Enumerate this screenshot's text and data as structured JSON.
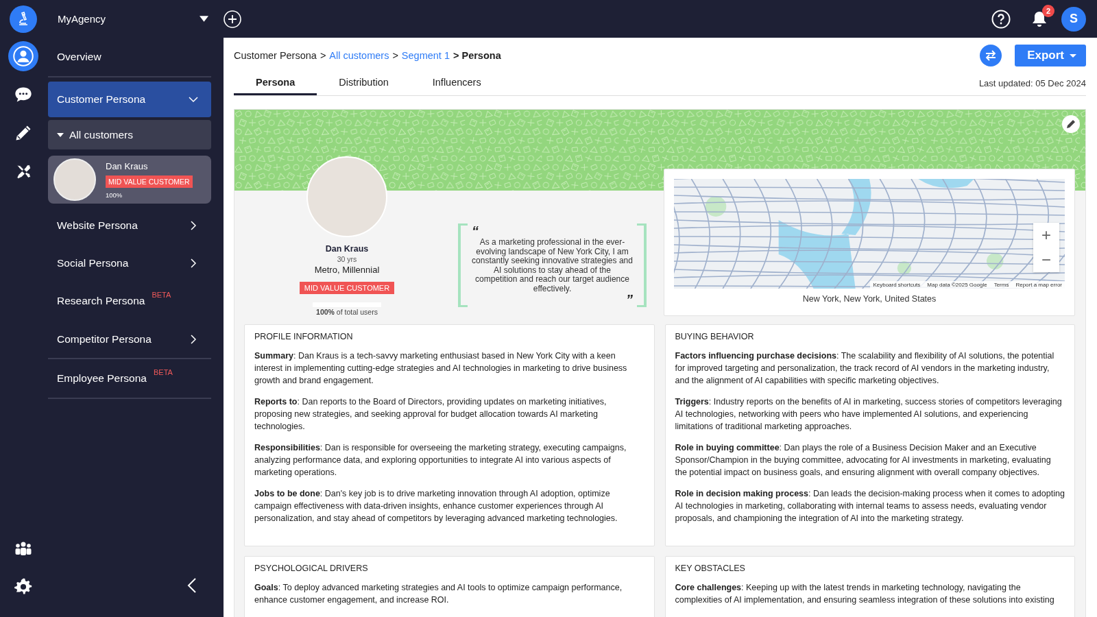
{
  "topbar": {
    "workspace": "MyAgency",
    "notifications": "2",
    "avatar": "S"
  },
  "rail": [
    {
      "selected": true
    },
    {
      "selected": false
    },
    {
      "selected": false
    },
    {
      "selected": false
    }
  ],
  "sidebar": {
    "items": [
      {
        "kind": "link",
        "label": "Overview",
        "selected": false
      },
      {
        "kind": "group",
        "label": "Customer Persona",
        "selected": true,
        "expanded": true,
        "children": [
          {
            "label": "All customers",
            "expanded": true,
            "children": [
              {
                "name": "Dan Kraus",
                "tag": "MID VALUE CUSTOMER",
                "share": "100%",
                "selected": true
              }
            ]
          }
        ]
      },
      {
        "kind": "group",
        "label": "Website Persona",
        "selected": false,
        "expanded": false
      },
      {
        "kind": "group",
        "label": "Social Persona",
        "selected": false,
        "expanded": false
      },
      {
        "kind": "link",
        "label": "Research Persona",
        "badge": "BETA",
        "selected": false
      },
      {
        "kind": "group",
        "label": "Competitor Persona",
        "selected": false,
        "expanded": false
      },
      {
        "kind": "link",
        "label": "Employee Persona",
        "badge": "BETA",
        "selected": false
      }
    ]
  },
  "breadcrumb": [
    {
      "kind": "text",
      "label": "Customer Persona"
    },
    {
      "kind": "separator",
      "label": ">"
    },
    {
      "kind": "link",
      "label": "All customers"
    },
    {
      "kind": "separator",
      "label": ">"
    },
    {
      "kind": "link",
      "label": "Segment 1"
    },
    {
      "kind": "current",
      "label": "> Persona"
    }
  ],
  "export_button": "Export",
  "tabs": [
    {
      "label": "Persona",
      "selected": true
    },
    {
      "label": "Distribution",
      "selected": false
    },
    {
      "label": "Influencers",
      "selected": false
    }
  ],
  "last_updated": "Last updated: 05 Dec 2024",
  "persona": {
    "name": "Dan Kraus",
    "age": "30 yrs",
    "segment": "Metro, Millennial",
    "tag": "MID VALUE CUSTOMER",
    "share": {
      "level": 1,
      "text": "**100%** of total users"
    },
    "quote_open": "“",
    "quote": "As a marketing professional in the ever-evolving landscape of New York City, I am constantly seeking innovative strategies and AI solutions to stay ahead of the competition and reach our target audience effectively.",
    "quote_close": "”",
    "map": {
      "zoom_in": "+",
      "zoom_out": "−",
      "attribution": [
        "Keyboard shortcuts",
        "Map data ©2025 Google",
        "Terms",
        "Report a map error"
      ],
      "location": "New York, New York, United States"
    }
  },
  "sections": [
    {
      "title": "PROFILE INFORMATION",
      "paragraphs": [
        "**Summary**: Dan Kraus is a tech-savvy marketing enthusiast based in New York City with a keen interest in implementing cutting-edge strategies and AI technologies in marketing to drive business growth and brand engagement.",
        "**Reports to**: Dan reports to the Board of Directors, providing updates on marketing initiatives, proposing new strategies, and seeking approval for budget allocation towards AI marketing technologies.",
        "**Responsibilities**: Dan is responsible for overseeing the marketing strategy, executing campaigns, analyzing performance data, and exploring opportunities to integrate AI into various aspects of marketing operations.",
        "**Jobs to be done**: Dan's key job is to drive marketing innovation through AI adoption, optimize campaign effectiveness with data-driven insights, enhance customer experiences through AI personalization, and stay ahead of competitors by leveraging advanced marketing technologies."
      ]
    },
    {
      "title": "BUYING BEHAVIOR",
      "paragraphs": [
        "**Factors influencing purchase decisions**: The scalability and flexibility of AI solutions, the potential for improved targeting and personalization, the track record of AI vendors in the marketing industry, and the alignment of AI capabilities with specific marketing objectives.",
        "**Triggers**: Industry reports on the benefits of AI in marketing, success stories of competitors leveraging AI technologies, networking with peers who have implemented AI solutions, and experiencing limitations of traditional marketing approaches.",
        "**Role in buying committee**: Dan plays the role of a Business Decision Maker and an Executive Sponsor/Champion in the buying committee, advocating for AI investments in marketing, evaluating the potential impact on business goals, and ensuring alignment with overall company objectives.",
        "**Role in decision making process**: Dan leads the decision-making process when it comes to adopting AI technologies in marketing, collaborating with internal teams to assess needs, evaluating vendor proposals, and championing the integration of AI into the marketing strategy."
      ]
    },
    {
      "title": "PSYCHOLOGICAL DRIVERS",
      "paragraphs": [
        "**Goals**: To deploy advanced marketing strategies and AI tools to optimize campaign performance, enhance customer engagement, and increase ROI."
      ]
    },
    {
      "title": "KEY OBSTACLES",
      "paragraphs": [
        "**Core challenges**: Keeping up with the latest trends in marketing technology, navigating the complexities of AI implementation, and ensuring seamless integration of these solutions into existing"
      ]
    }
  ]
}
